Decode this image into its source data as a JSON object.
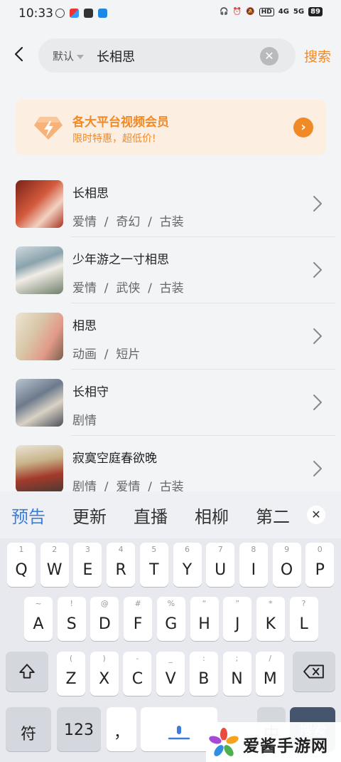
{
  "status_bar": {
    "time": "10:33",
    "net1": "4G",
    "net2": "5G",
    "hd": "HD",
    "battery": "89"
  },
  "search": {
    "filter_label": "默认",
    "query": "长相思",
    "search_label": "搜索"
  },
  "banner": {
    "title": "各大平台视频会员",
    "subtitle": "限时特惠，超低价!"
  },
  "results": [
    {
      "title": "长相思",
      "tags": "爱情  /  奇幻  /  古装"
    },
    {
      "title": "少年游之一寸相思",
      "tags": "爱情  /  武侠  /  古装"
    },
    {
      "title": "相思",
      "tags": "动画  /  短片"
    },
    {
      "title": "长相守",
      "tags": "剧情"
    },
    {
      "title": "寂寞空庭春欲晚",
      "tags": "剧情  /  爱情  /  古装"
    }
  ],
  "keyboard": {
    "candidates": [
      "预告",
      "更新",
      "直播",
      "相柳",
      "第二"
    ],
    "row1": [
      {
        "k": "Q",
        "h": "1"
      },
      {
        "k": "W",
        "h": "2"
      },
      {
        "k": "E",
        "h": "3"
      },
      {
        "k": "R",
        "h": "4"
      },
      {
        "k": "T",
        "h": "5"
      },
      {
        "k": "Y",
        "h": "6"
      },
      {
        "k": "U",
        "h": "7"
      },
      {
        "k": "I",
        "h": "8"
      },
      {
        "k": "O",
        "h": "9"
      },
      {
        "k": "P",
        "h": "0"
      }
    ],
    "row2": [
      {
        "k": "A",
        "h": "~"
      },
      {
        "k": "S",
        "h": "!"
      },
      {
        "k": "D",
        "h": "@"
      },
      {
        "k": "F",
        "h": "#"
      },
      {
        "k": "G",
        "h": "%"
      },
      {
        "k": "H",
        "h": "“"
      },
      {
        "k": "J",
        "h": "”"
      },
      {
        "k": "K",
        "h": "*"
      },
      {
        "k": "L",
        "h": "?"
      }
    ],
    "row3": [
      {
        "k": "Z",
        "h": "("
      },
      {
        "k": "X",
        "h": ")"
      },
      {
        "k": "C",
        "h": "-"
      },
      {
        "k": "V",
        "h": "_"
      },
      {
        "k": "B",
        "h": ":"
      },
      {
        "k": "N",
        "h": ";"
      },
      {
        "k": "M",
        "h": "/"
      }
    ],
    "symbols_label": "符",
    "numbers_label": "123",
    "comma_label": "，",
    "lang_label": "中",
    "enter_label": "搜索"
  },
  "watermark": {
    "text": "爱酱手游网"
  },
  "colors": {
    "accent": "#f08a27",
    "candidate_active": "#3c7ddc",
    "enter_key": "#45556e"
  }
}
